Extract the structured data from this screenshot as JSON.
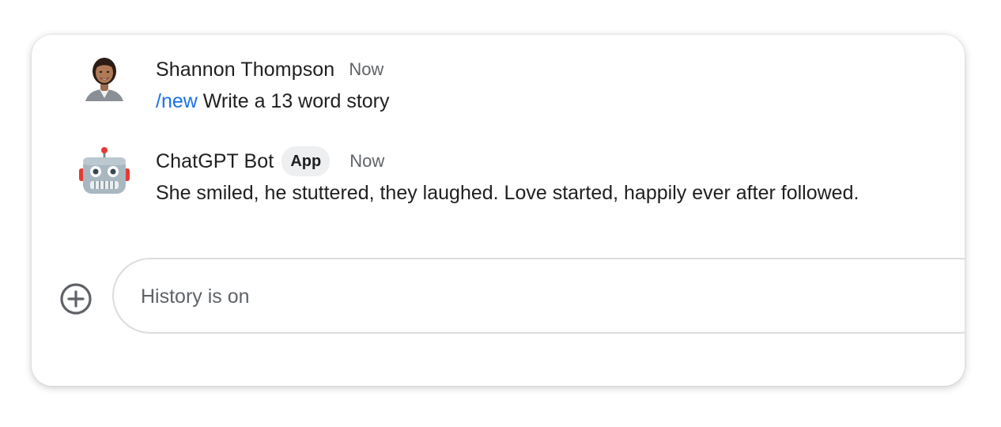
{
  "messages": [
    {
      "sender": "Shannon Thompson",
      "time": "Now",
      "command": "/new",
      "text": " Write a 13 word story",
      "avatar": "woman-portrait-avatar"
    },
    {
      "sender": "ChatGPT Bot",
      "badge": "App",
      "time": "Now",
      "text": "She smiled, he stuttered, they laughed. Love started, happily ever after followed.",
      "avatar": "robot-icon"
    }
  ],
  "compose": {
    "placeholder": "History is on",
    "add_icon": "add-circle-icon"
  },
  "colors": {
    "command_link": "#1a73e8",
    "text": "#1f1f1f",
    "muted": "#5f6368",
    "badge_bg": "#eeeff1",
    "border": "#dadce0"
  }
}
